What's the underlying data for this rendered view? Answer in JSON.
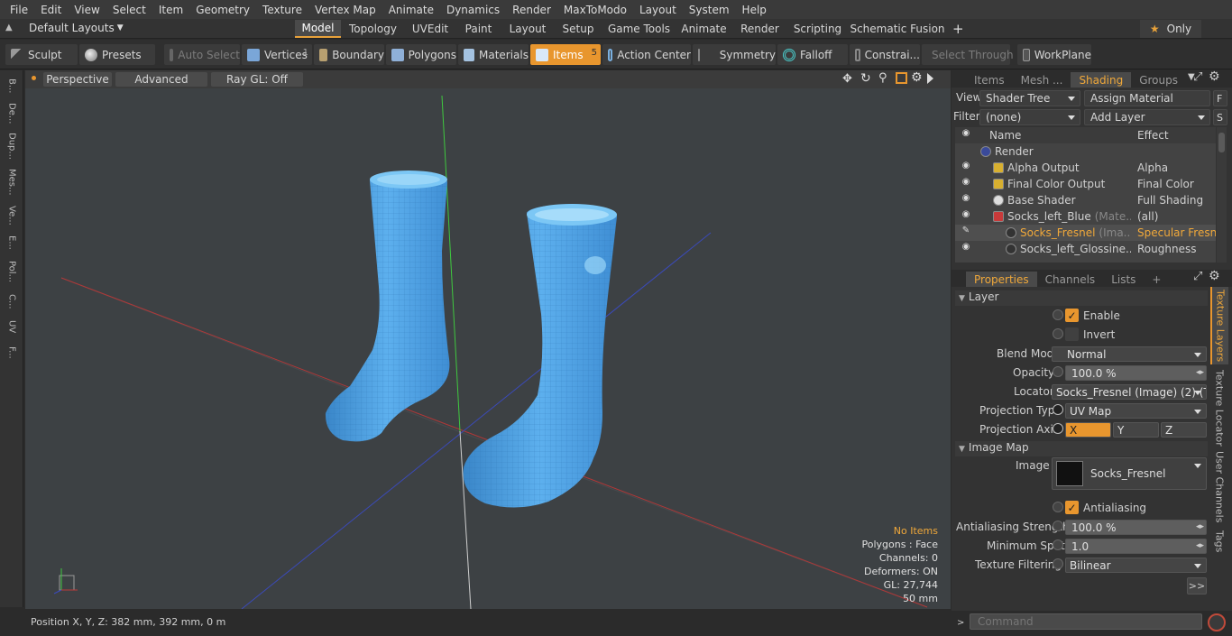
{
  "menu": [
    "File",
    "Edit",
    "View",
    "Select",
    "Item",
    "Geometry",
    "Texture",
    "Vertex Map",
    "Animate",
    "Dynamics",
    "Render",
    "MaxToModo",
    "Layout",
    "System",
    "Help"
  ],
  "layout_bar": {
    "layouts_label": "Default Layouts",
    "tabs": [
      "Model",
      "Topology",
      "UVEdit",
      "Paint",
      "Layout",
      "Setup",
      "Game Tools",
      "Animate",
      "Render",
      "Scripting",
      "Schematic Fusion"
    ],
    "active_tab": "Model",
    "add_symbol": "+",
    "star": "★",
    "only_label": "Only"
  },
  "toolbar": {
    "sculpt": "Sculpt",
    "presets": "Presets",
    "auto_select": "Auto Select",
    "vertices": "Vertices",
    "vertices_count": "1",
    "boundary": "Boundary",
    "polygons": "Polygons",
    "materials": "Materials",
    "items": "Items",
    "items_count": "5",
    "action_center": "Action Center",
    "symmetry": "Symmetry",
    "falloff": "Falloff",
    "constraints": "Constrai...",
    "select_through": "Select Through",
    "workplane": "WorkPlane"
  },
  "left_strip": [
    "B...",
    "De...",
    "Dup...",
    "Mes...",
    "Ve...",
    "E...",
    "Pol...",
    "C...",
    "UV",
    "F..."
  ],
  "viewport": {
    "perspective": "Perspective",
    "advanced": "Advanced",
    "raygl": "Ray GL: Off",
    "stats": {
      "no_items": "No Items",
      "polygons": "Polygons : Face",
      "channels": "Channels: 0",
      "deformers": "Deformers: ON",
      "gl": "GL: 27,744",
      "size": "50 mm"
    }
  },
  "status": {
    "position": "Position X, Y, Z:   382 mm, 392 mm, 0 m"
  },
  "right_panel": {
    "top_tabs": [
      "Items",
      "Mesh ...",
      "Shading",
      "Groups"
    ],
    "top_active": "Shading",
    "view_label": "View",
    "view_value": "Shader Tree",
    "assign_material": "Assign Material",
    "f_btn": "F",
    "filter_label": "Filter",
    "filter_value": "(none)",
    "add_layer": "Add Layer",
    "s_btn": "S",
    "tree_header": {
      "name": "Name",
      "effect": "Effect"
    },
    "tree_rows": [
      {
        "name": "Render",
        "sub": "",
        "effect": ""
      },
      {
        "name": "Alpha Output",
        "sub": "",
        "effect": "Alpha"
      },
      {
        "name": "Final Color Output",
        "sub": "",
        "effect": "Final Color"
      },
      {
        "name": "Base Shader",
        "sub": "",
        "effect": "Full Shading"
      },
      {
        "name": "Socks_left_Blue",
        "sub": "(Mate...",
        "effect": "(all)"
      },
      {
        "name": "Socks_Fresnel",
        "sub": "(Ima...",
        "effect": "Specular Fresn..."
      },
      {
        "name": "Socks_left_Glossine...",
        "sub": "",
        "effect": "Roughness"
      }
    ],
    "prop_tabs": [
      "Properties",
      "Channels",
      "Lists"
    ],
    "prop_active": "Properties",
    "layer_section": "Layer",
    "enable": "Enable",
    "invert": "Invert",
    "blend_mode_label": "Blend Mode",
    "blend_mode_value": "Normal",
    "opacity_label": "Opacity",
    "opacity_value": "100.0 %",
    "locator_label": "Locator",
    "locator_value": "Socks_Fresnel (Image) (2) (T ...",
    "projection_type_label": "Projection Type",
    "projection_type_value": "UV Map",
    "projection_axis_label": "Projection Axis",
    "axis_x": "X",
    "axis_y": "Y",
    "axis_z": "Z",
    "image_map_section": "Image Map",
    "image_label": "Image",
    "image_value": "Socks_Fresnel",
    "antialiasing": "Antialiasing",
    "aa_strength_label": "Antialiasing Strength",
    "aa_strength_value": "100.0 %",
    "min_spot_label": "Minimum Spot",
    "min_spot_value": "1.0",
    "tex_filter_label": "Texture Filtering",
    "tex_filter_value": "Bilinear",
    "more_btn": ">>",
    "side_tabs": [
      "Texture Layers",
      "Texture Locator",
      "User Channels",
      "Tags"
    ],
    "side_active": "Texture Layers",
    "command_placeholder": "Command"
  },
  "colors": {
    "accent": "#e8962e",
    "sock": "#4a9ee0",
    "axis_x": "#c03a3a",
    "axis_y": "#3ac03a",
    "axis_z": "#3a3ac0"
  }
}
